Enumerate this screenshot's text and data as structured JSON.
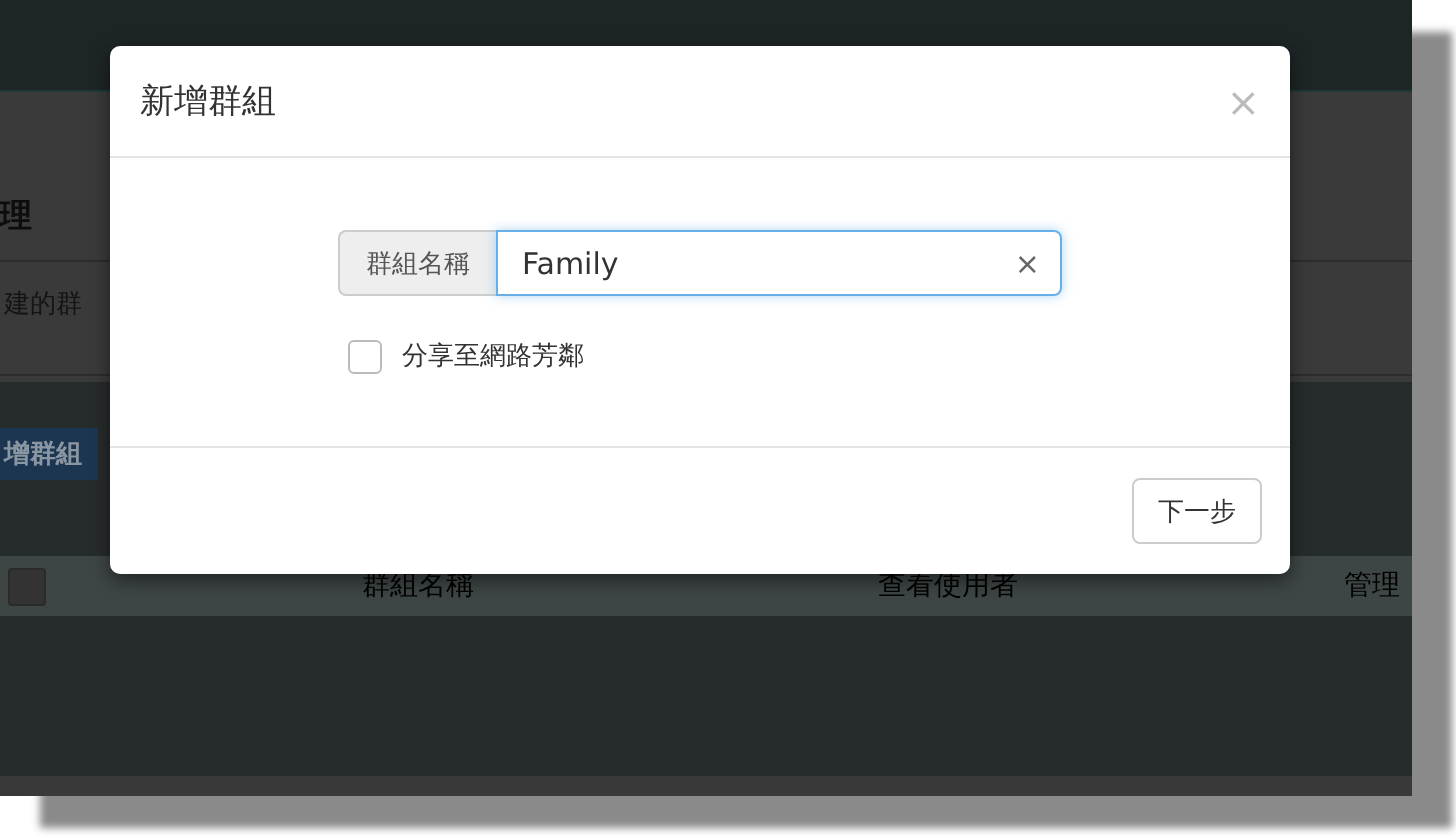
{
  "background_page": {
    "heading": "理",
    "description": "建的群",
    "add_button": "增群組",
    "table": {
      "select_all": {
        "checked": false
      },
      "columns": [
        "群組名稱",
        "查看使用者",
        "管理"
      ]
    }
  },
  "dialog": {
    "title": "新增群組",
    "close": "×",
    "field": {
      "label": "群組名稱",
      "value": "Family",
      "clear": "×"
    },
    "share_checkbox": {
      "label": "分享至網路芳鄰",
      "checked": false
    },
    "buttons": [
      "下一步"
    ]
  }
}
